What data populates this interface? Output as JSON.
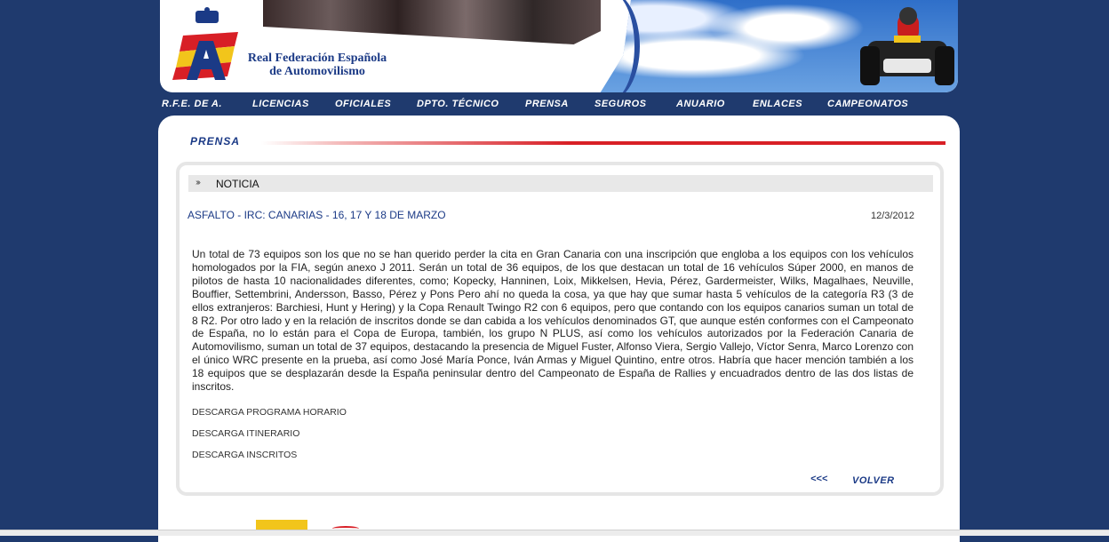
{
  "header": {
    "brand_line1": "Real Federación Española",
    "brand_line2": "de Automovilismo"
  },
  "menu": [
    "R.F.E. DE A.",
    "LICENCIAS",
    "OFICIALES",
    "DPTO. TÉCNICO",
    "PRENSA",
    "SEGUROS",
    "ANUARIO",
    "ENLACES",
    "CAMPEONATOS"
  ],
  "section": {
    "title": "PRENSA"
  },
  "news": {
    "bar_label": "NOTICIA",
    "headline": "ASFALTO - IRC: CANARIAS - 16, 17 Y 18 DE MARZO",
    "date": "12/3/2012",
    "body": "Un total de 73 equipos son los que no se han querido perder la cita en Gran Canaria con una inscripción que engloba a los equipos con los vehículos homologados por la FIA, según anexo J 2011. Serán un total de 36 equipos, de los que destacan un total de 16 vehículos Súper 2000, en manos de pilotos de hasta 10 nacionalidades diferentes, como; Kopecky, Hanninen, Loix, Mikkelsen, Hevia, Pérez, Gardermeister, Wilks, Magalhaes, Neuville, Bouffier, Settembrini, Andersson, Basso, Pérez y Pons Pero ahí no queda la cosa, ya que hay que sumar hasta 5 vehículos de la categoría R3 (3 de ellos extranjeros: Barchiesi, Hunt y Hering) y la Copa Renault Twingo R2 con 6 equipos, pero que contando con los equipos canarios suman un total de 8 R2. Por otro lado y en la relación de inscritos donde se dan cabida a los vehículos denominados GT, que aunque estén conformes con el Campeonato de España, no lo están para el Copa de Europa, también, los grupo N PLUS, así como los vehículos autorizados por la Federación Canaria de Automovilismo, suman un total de 37 equipos, destacando la presencia de Miguel Fuster, Alfonso Viera, Sergio Vallejo, Víctor Senra, Marco Lorenzo con el único WRC presente en la prueba, así como José María Ponce, Iván Armas y Miguel Quintino, entre otros. Habría que hacer mención también a los 18 equipos que se desplazarán desde la España peninsular dentro del Campeonato de España de Rallies y encuadrados dentro de las dos listas de inscritos.",
    "downloads": [
      "DESCARGA PROGRAMA HORARIO",
      "DESCARGA ITINERARIO",
      "DESCARGA INSCRITOS"
    ],
    "back_arrows": "<<<",
    "back_label": "VOLVER"
  }
}
